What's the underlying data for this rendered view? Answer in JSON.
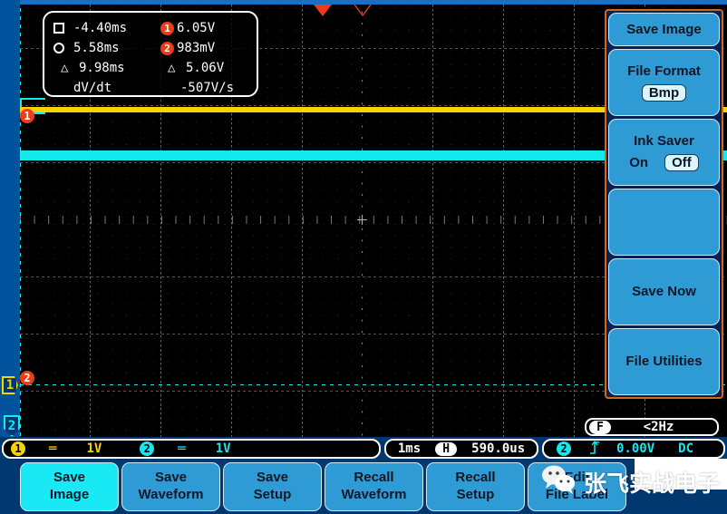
{
  "device": "digital-oscilloscope",
  "measurements": {
    "rows": [
      {
        "marker": "square-cursor-icon",
        "time": "-4.40ms",
        "badge": "1",
        "value": "6.05V"
      },
      {
        "marker": "circle-cursor-icon",
        "time": "5.58ms",
        "badge": "2",
        "value": "983mV"
      },
      {
        "marker": "delta",
        "time": "9.98ms",
        "badge": "",
        "value": "5.06V"
      },
      {
        "marker": "none",
        "time": "dV/dt",
        "badge": "",
        "value": "-507V/s"
      }
    ],
    "delta_symbol": "△"
  },
  "side_menu": {
    "items": [
      {
        "label": "Save Image",
        "value": null,
        "options": null,
        "size": "small"
      },
      {
        "label": "File Format",
        "value": "Bmp",
        "options": null,
        "size": "medium"
      },
      {
        "label": "Ink Saver",
        "value": "Off",
        "options": [
          "On",
          "Off"
        ],
        "size": "medium"
      },
      {
        "label": "",
        "value": null,
        "options": null,
        "size": "medium"
      },
      {
        "label": "Save Now",
        "value": null,
        "options": null,
        "size": "medium"
      },
      {
        "label": "File Utilities",
        "value": null,
        "options": null,
        "size": "medium"
      }
    ],
    "border_color": "#d2661a",
    "button_color": "#2f9bd4"
  },
  "frequency_counter": {
    "badge": "F",
    "reading": "<2Hz"
  },
  "status_bar": {
    "channel1": {
      "badge": "1",
      "coupling": "═",
      "volts_div": "1V",
      "color": "#f5d400"
    },
    "channel2": {
      "badge": "2",
      "coupling": "═",
      "volts_div": "1V",
      "color": "#14e9ef"
    },
    "timebase": {
      "scale": "1ms",
      "icon": "H",
      "position": "590.0us"
    },
    "trigger": {
      "source_badge": "2",
      "slope_icon": "rising-edge",
      "level": "0.00V",
      "coupling": "DC",
      "color": "#14e9ef"
    }
  },
  "bottom_menu": {
    "buttons": [
      {
        "line1": "Save",
        "line2": "Image",
        "active": true
      },
      {
        "line1": "Save",
        "line2": "Waveform",
        "active": false
      },
      {
        "line1": "Save",
        "line2": "Setup",
        "active": false
      },
      {
        "line1": "Recall",
        "line2": "Waveform",
        "active": false
      },
      {
        "line1": "Recall",
        "line2": "Setup",
        "active": false
      },
      {
        "line1": "Edit",
        "line2": "File Label",
        "active": false
      }
    ]
  },
  "watermark": {
    "text": "张飞实战电子",
    "icon": "wechat-icon"
  },
  "markers": {
    "ch1_ground_tag": "1",
    "ch2_ground_tag": "2",
    "cursor1_badge": "1",
    "cursor2_badge": "2"
  }
}
